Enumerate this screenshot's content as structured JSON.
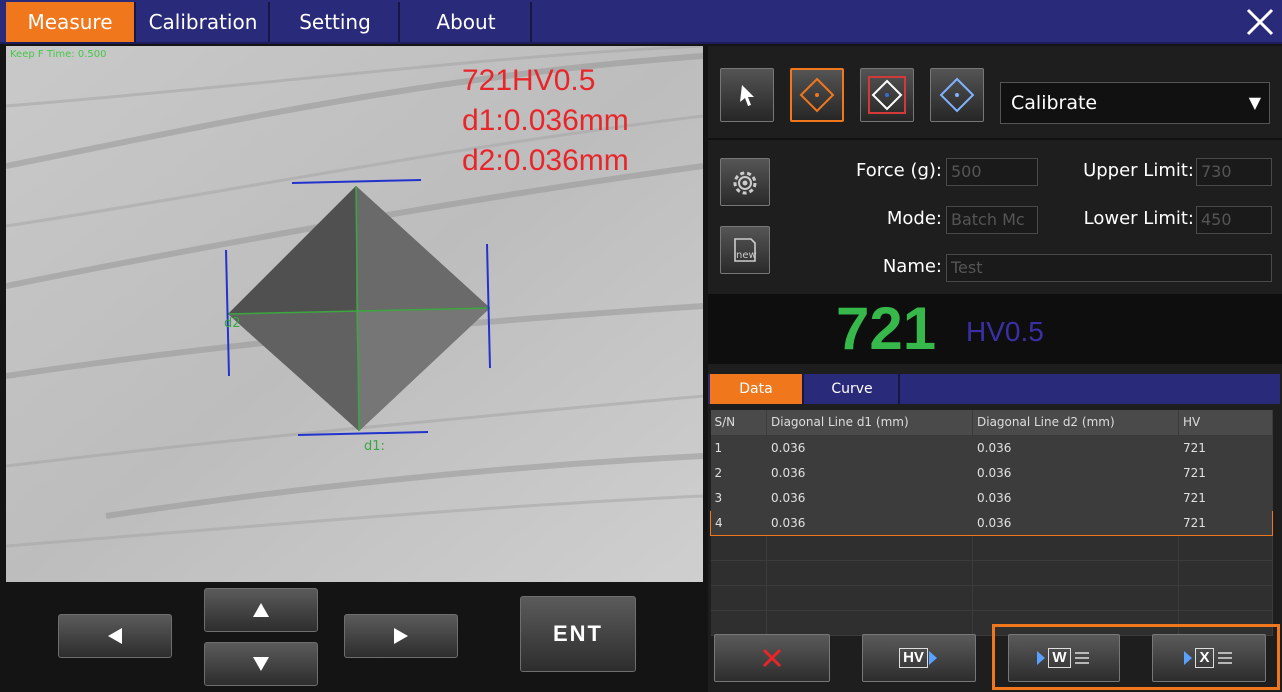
{
  "menu": {
    "tabs": [
      {
        "label": "Measure"
      },
      {
        "label": "Calibration"
      },
      {
        "label": "Setting"
      },
      {
        "label": "About"
      }
    ]
  },
  "camera": {
    "keep_time": "Keep F Time: 0.500",
    "overlay_lines": [
      "721HV0.5",
      "d1:0.036mm",
      "d2:0.036mm"
    ],
    "d1_label": "d1:",
    "d2_label": "d2"
  },
  "nav": {
    "up_icon": "triangle-up-icon",
    "down_icon": "triangle-down-icon",
    "left_icon": "triangle-left-icon",
    "right_icon": "triangle-right-icon",
    "ent_label": "ENT"
  },
  "tools": {
    "mode_select_value": "Calibrate",
    "icons": [
      "pointer-arrow-icon",
      "diamond-measure-icon",
      "diamond-box-measure-icon",
      "diamond-auto-icon"
    ]
  },
  "form": {
    "force_label": "Force (g):",
    "force_value": "500",
    "mode_label": "Mode:",
    "mode_value": "Batch Mc",
    "name_label": "Name:",
    "name_value": "Test",
    "upper_label": "Upper Limit:",
    "upper_value": "730",
    "lower_label": "Lower Limit:",
    "lower_value": "450"
  },
  "result": {
    "value": "721",
    "unit": "HV0.5"
  },
  "data_tabs": [
    {
      "label": "Data"
    },
    {
      "label": "Curve"
    }
  ],
  "table": {
    "headers": [
      "S/N",
      "Diagonal Line d1 (mm)",
      "Diagonal Line d2 (mm)",
      "HV"
    ],
    "rows": [
      [
        "1",
        "0.036",
        "0.036",
        "721"
      ],
      [
        "2",
        "0.036",
        "0.036",
        "721"
      ],
      [
        "3",
        "0.036",
        "0.036",
        "721"
      ],
      [
        "4",
        "0.036",
        "0.036",
        "721"
      ]
    ]
  },
  "actions": {
    "hv_label": "HV",
    "word_label": "W",
    "excel_label": "X"
  },
  "colors": {
    "accent": "#f0771c",
    "menu_bg": "#2a2a7a",
    "result_value": "#36b84a",
    "result_unit": "#3b2fa6",
    "overlay_text": "#e8262a"
  }
}
